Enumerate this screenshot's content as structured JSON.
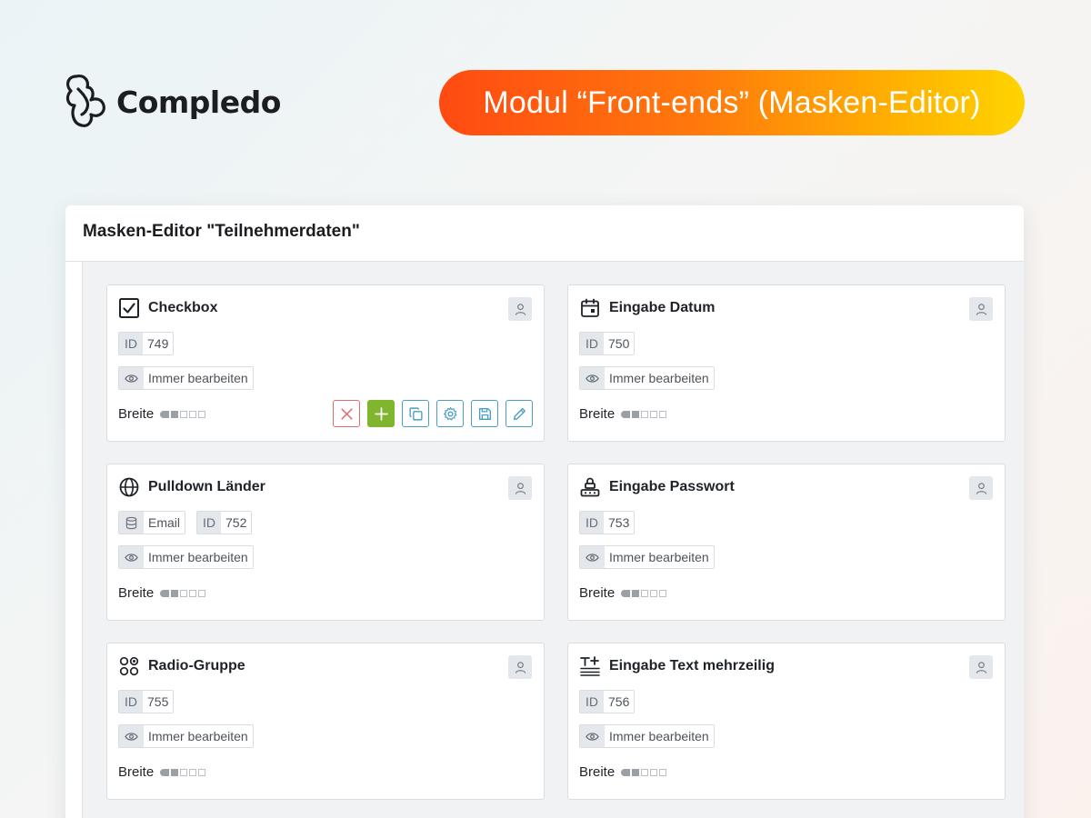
{
  "brand": {
    "name": "Compledo"
  },
  "banner": {
    "text": "Modul “Front-ends” (Masken-Editor)"
  },
  "editor": {
    "title": "Masken-Editor \"Teilnehmerdaten\""
  },
  "labels": {
    "id": "ID",
    "visibility": "Immer bearbeiten",
    "width": "Breite",
    "email": "Email"
  },
  "fields": [
    {
      "title": "Checkbox",
      "icon": "checkbox-icon",
      "id": "749",
      "width_level": 2,
      "width_max": 5
    },
    {
      "title": "Eingabe Datum",
      "icon": "calendar-icon",
      "id": "750",
      "width_level": 2,
      "width_max": 5
    },
    {
      "title": "Pulldown Länder",
      "icon": "globe-icon",
      "id": "752",
      "width_level": 2,
      "width_max": 5
    },
    {
      "title": "Eingabe Passwort",
      "icon": "password-icon",
      "id": "753",
      "width_level": 2,
      "width_max": 5
    },
    {
      "title": "Radio-Gruppe",
      "icon": "radio-group-icon",
      "id": "755",
      "width_level": 2,
      "width_max": 5
    },
    {
      "title": "Eingabe Text mehrzeilig",
      "icon": "text-multiline-icon",
      "id": "756",
      "width_level": 2,
      "width_max": 5
    }
  ],
  "actions": [
    "delete-icon",
    "plus-icon",
    "copy-icon",
    "settings-icon",
    "save-icon",
    "edit-icon"
  ],
  "colors": {
    "banner_start": "#ff4a12",
    "banner_end": "#ffd400",
    "add_button": "#7fb62d",
    "delete_border": "#e06b6b",
    "action_border": "#4a9ec4"
  }
}
